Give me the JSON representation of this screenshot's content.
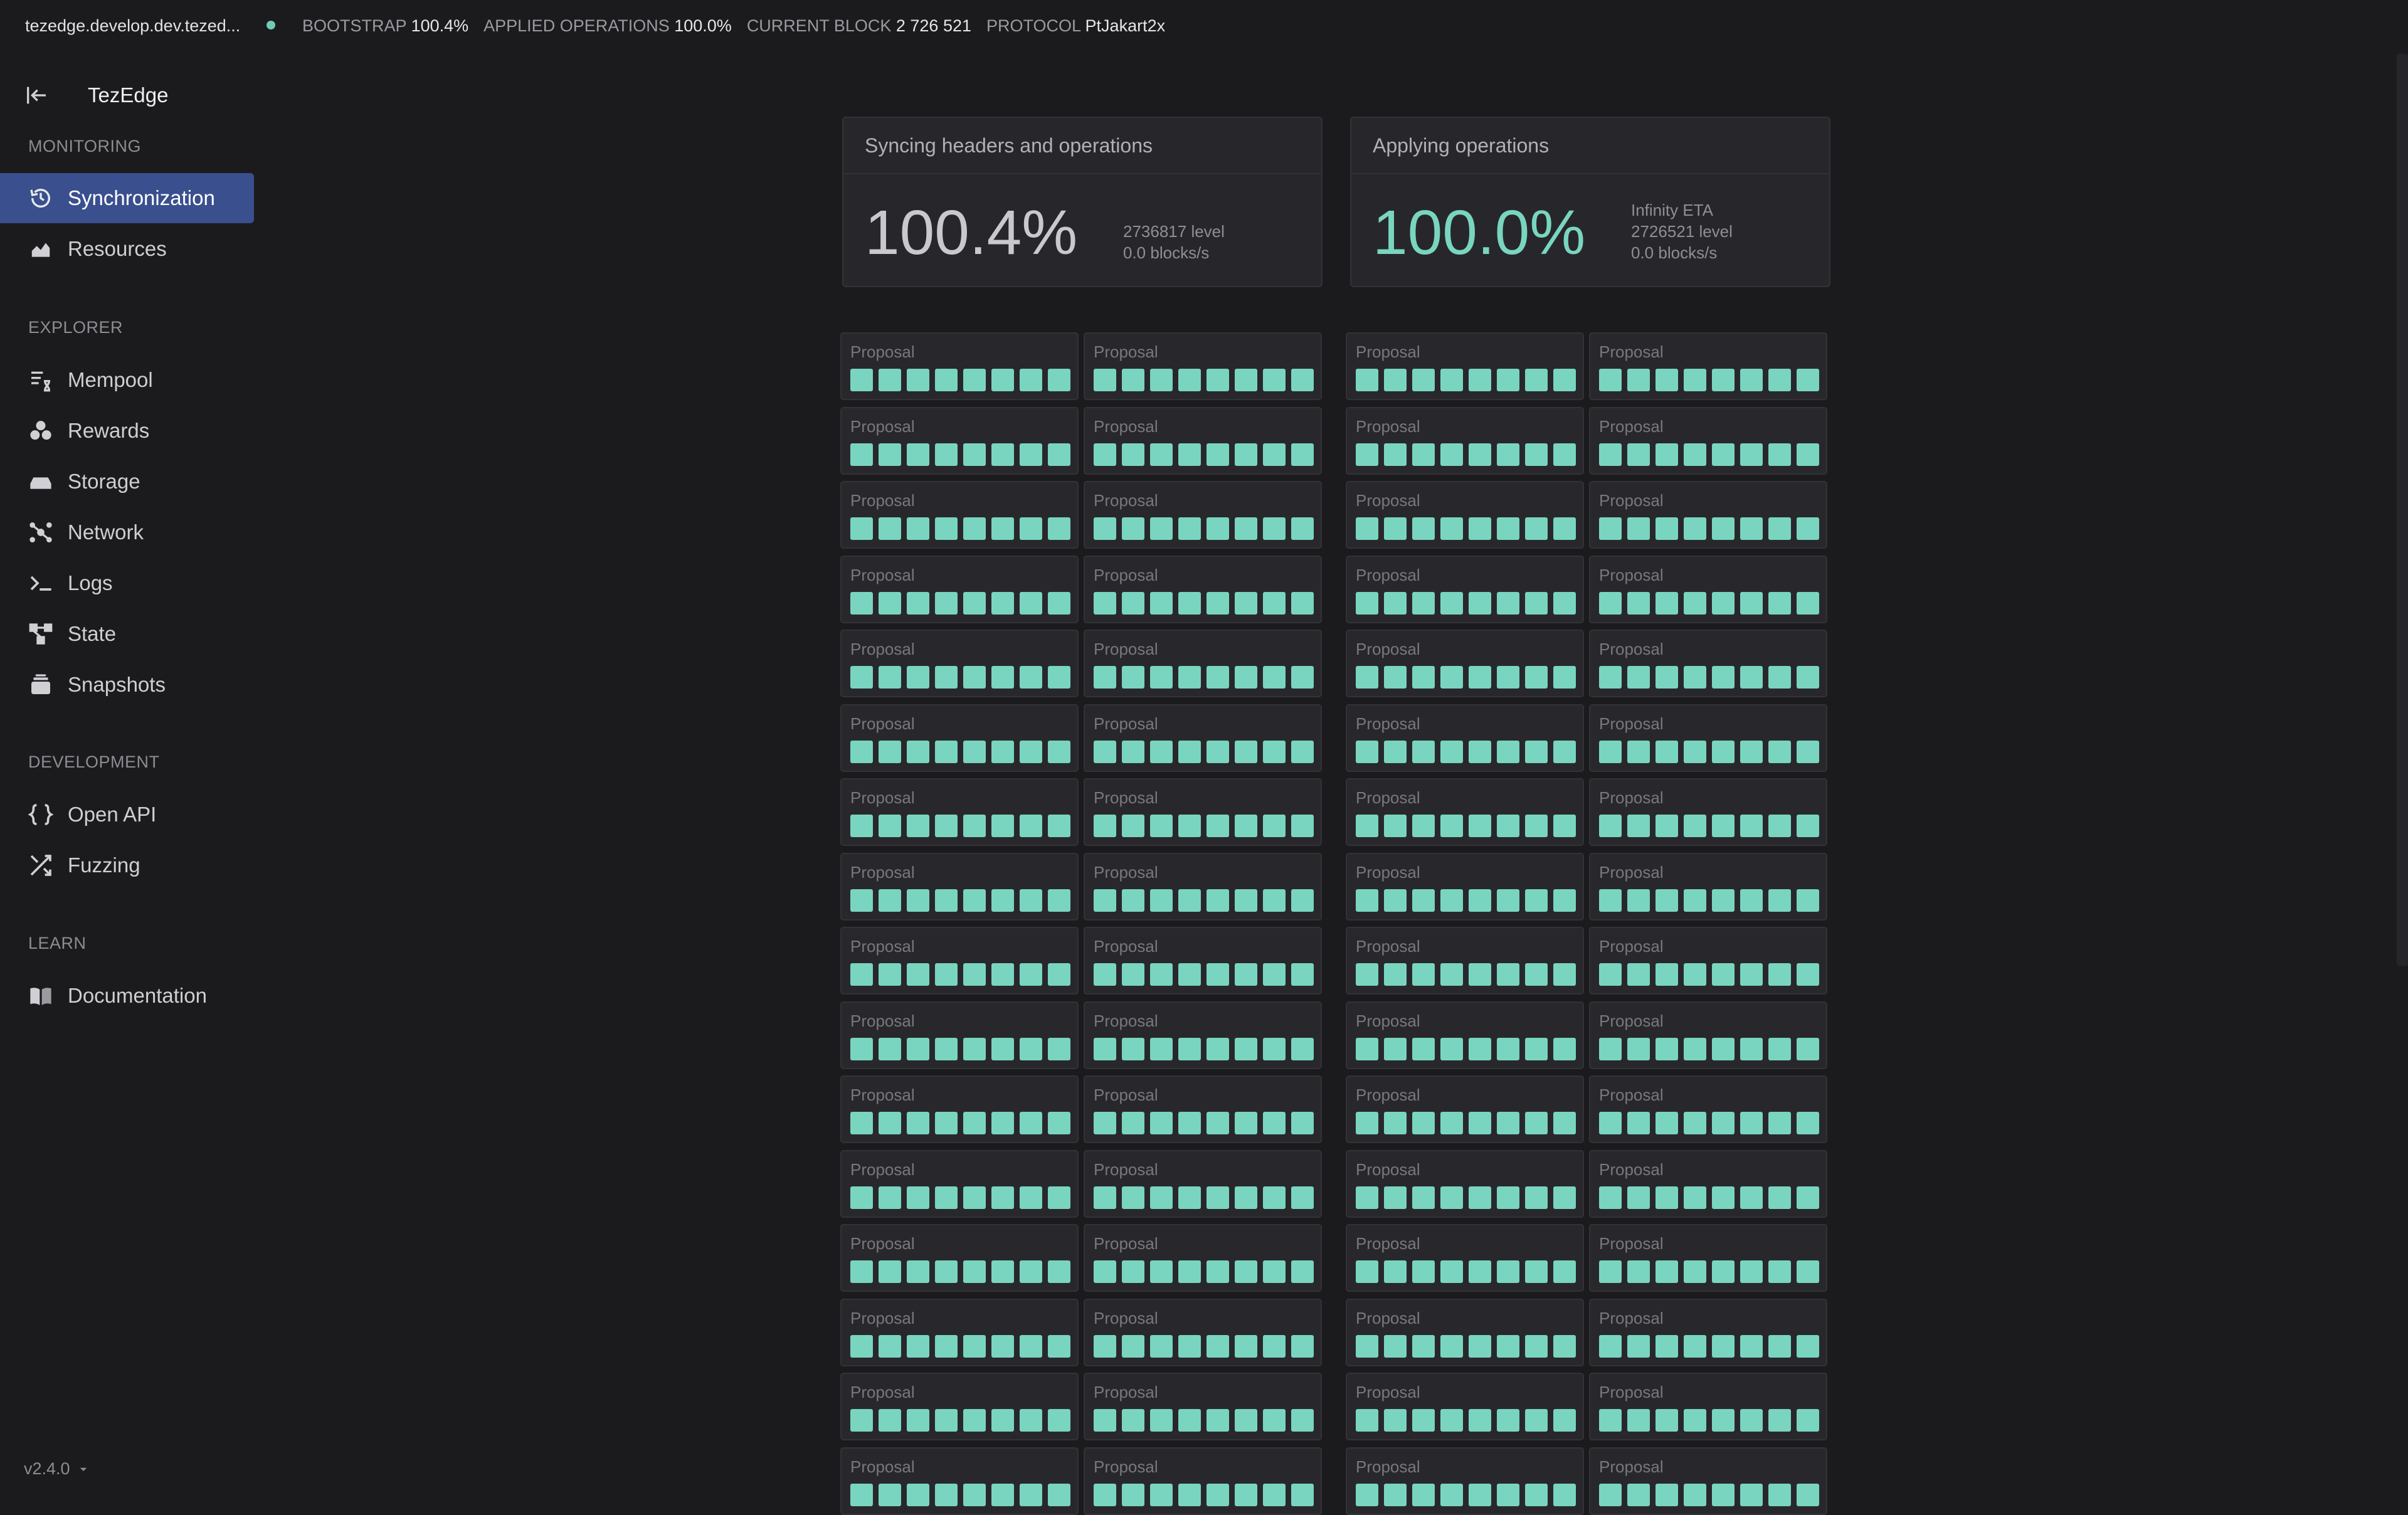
{
  "topbar": {
    "host": "tezedge.develop.dev.tezed...",
    "stats": [
      {
        "label": "BOOTSTRAP",
        "value": "100.4%"
      },
      {
        "label": "APPLIED OPERATIONS",
        "value": "100.0%"
      },
      {
        "label": "CURRENT BLOCK",
        "value": "2 726 521"
      },
      {
        "label": "PROTOCOL",
        "value": "PtJakart2x"
      }
    ],
    "status_color": "#6fcbb5"
  },
  "sidebar": {
    "brand": "TezEdge",
    "sections": {
      "monitoring": "MONITORING",
      "explorer": "EXPLORER",
      "development": "DEVELOPMENT",
      "learn": "LEARN"
    },
    "items": {
      "synchronization": "Synchronization",
      "resources": "Resources",
      "mempool": "Mempool",
      "rewards": "Rewards",
      "storage": "Storage",
      "network": "Network",
      "logs": "Logs",
      "state": "State",
      "snapshots": "Snapshots",
      "open_api": "Open API",
      "fuzzing": "Fuzzing",
      "documentation": "Documentation"
    },
    "version": "v2.4.0",
    "active_color": "#3a4f8e"
  },
  "cards": {
    "syncing": {
      "title": "Syncing headers and operations",
      "percent": "100.4%",
      "level": "2736817 level",
      "rate": "0.0 blocks/s"
    },
    "applying": {
      "title": "Applying operations",
      "percent": "100.0%",
      "eta": "Infinity ETA",
      "level": "2726521 level",
      "rate": "0.0 blocks/s"
    }
  },
  "blocks": {
    "label": "Proposal",
    "rows": 16,
    "columns": 4,
    "squares_per_block": 8,
    "square_color": "#79d5c0"
  }
}
